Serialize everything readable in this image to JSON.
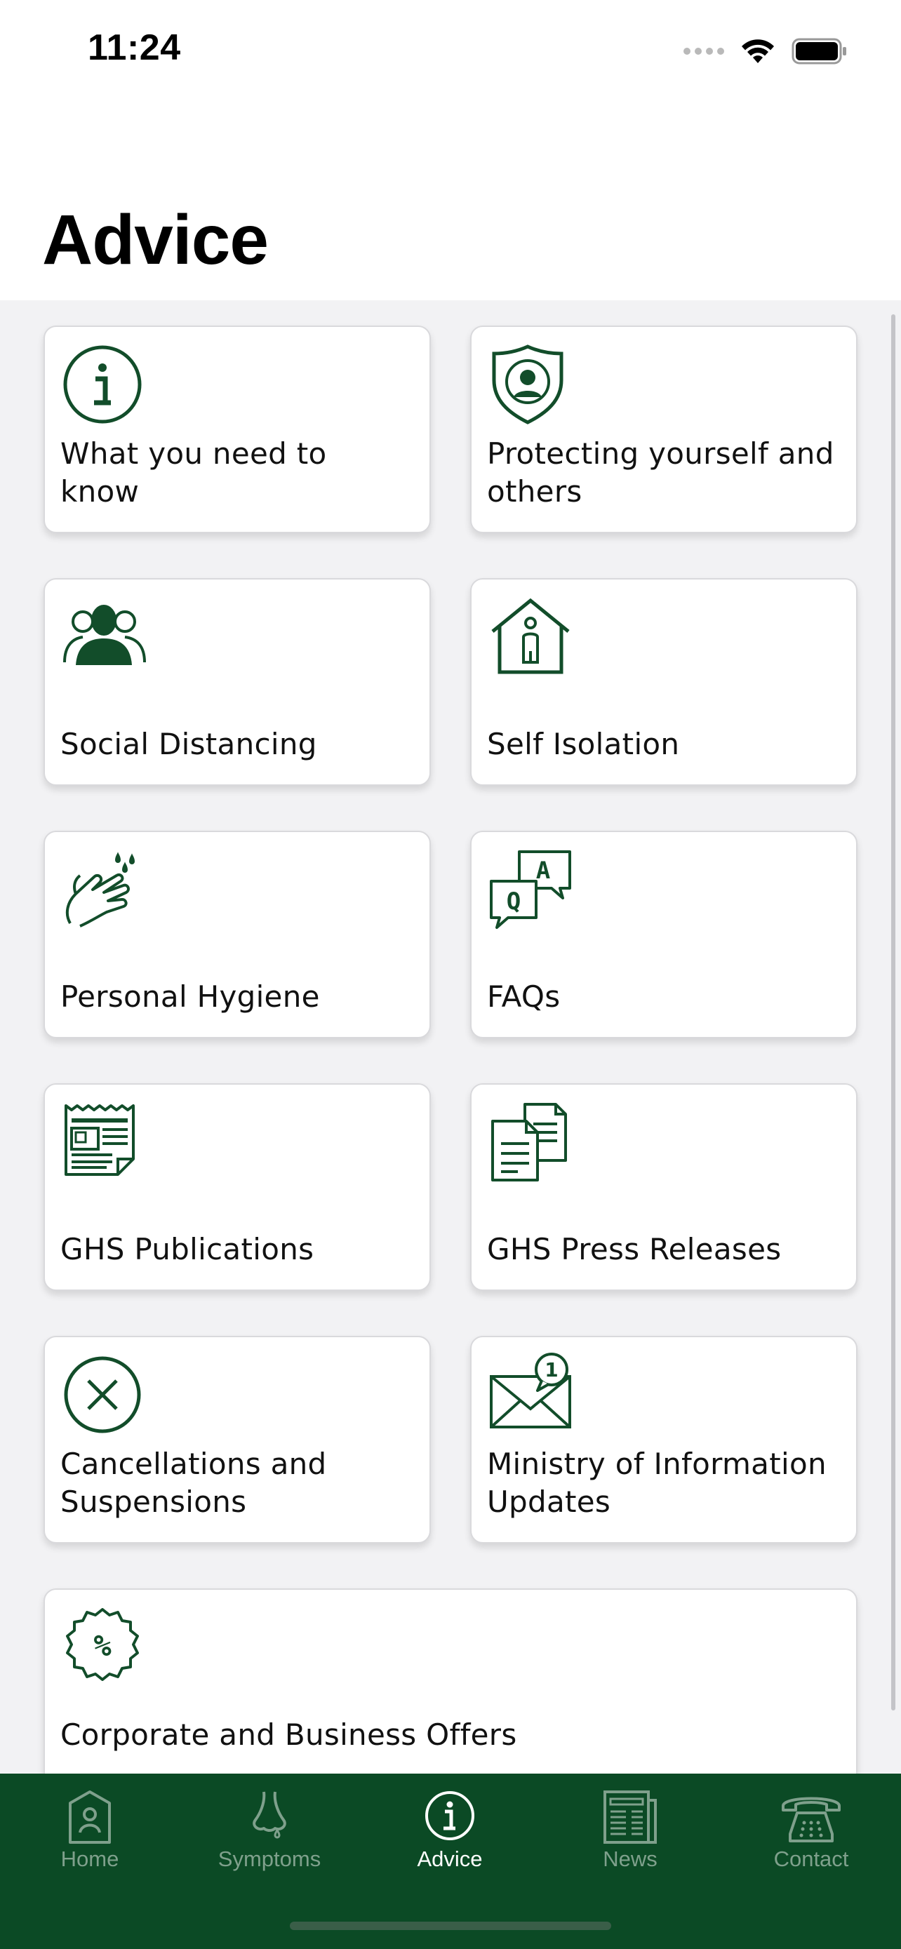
{
  "status_bar": {
    "time": "11:24"
  },
  "header": {
    "title": "Advice"
  },
  "colors": {
    "brand_green": "#0b4a25",
    "icon_green": "#124d2a",
    "tab_inactive": "#7fa08c",
    "background": "#f2f2f4"
  },
  "cards": [
    {
      "label": "What you need to know",
      "icon": "info-circle-icon"
    },
    {
      "label": "Protecting yourself and others",
      "icon": "shield-person-icon"
    },
    {
      "label": "Social Distancing",
      "icon": "group-people-icon"
    },
    {
      "label": "Self Isolation",
      "icon": "house-person-icon"
    },
    {
      "label": "Personal Hygiene",
      "icon": "hand-wash-icon"
    },
    {
      "label": "FAQs",
      "icon": "qa-bubbles-icon"
    },
    {
      "label": "GHS Publications",
      "icon": "newspaper-icon"
    },
    {
      "label": "GHS Press Releases",
      "icon": "documents-icon"
    },
    {
      "label": "Cancellations and Suspensions",
      "icon": "cancel-circle-icon"
    },
    {
      "label": "Ministry of Information Updates",
      "icon": "mail-notification-icon"
    },
    {
      "label": "Corporate and Business Offers",
      "icon": "percent-badge-icon"
    }
  ],
  "tabs": [
    {
      "label": "Home",
      "icon": "home-icon",
      "active": false
    },
    {
      "label": "Symptoms",
      "icon": "nose-icon",
      "active": false
    },
    {
      "label": "Advice",
      "icon": "info-icon",
      "active": true
    },
    {
      "label": "News",
      "icon": "newspaper-icon",
      "active": false
    },
    {
      "label": "Contact",
      "icon": "telephone-icon",
      "active": false
    }
  ]
}
